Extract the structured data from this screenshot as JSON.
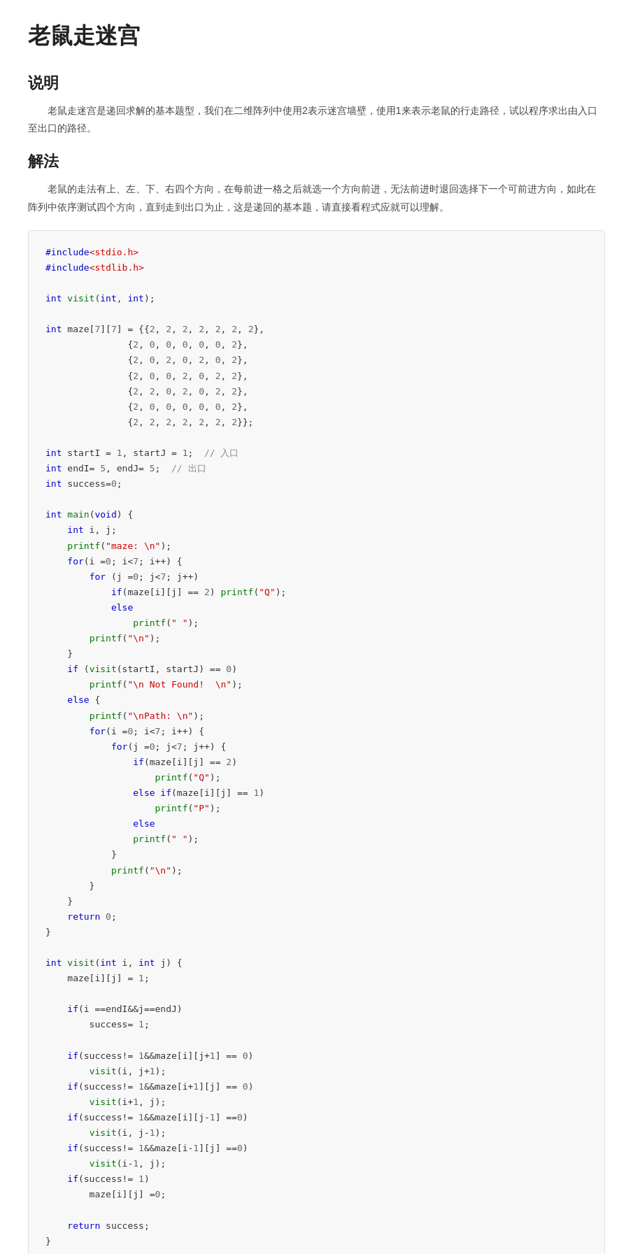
{
  "page": {
    "title": "老鼠走迷宫",
    "sections": [
      {
        "heading": "说明",
        "content": "老鼠走迷宫是递回求解的基本题型，我们在二维阵列中使用2表示迷宫墙壁，使用1来表示老鼠的行走路径，试以程序求出由入口至出口的路径。"
      },
      {
        "heading": "解法",
        "content": "老鼠的走法有上、左、下、右四个方向，在每前进一格之后就选一个方向前进，无法前进时退回选择下一个可前进方向，如此在阵列中依序测试四个方向，直到走到出口为止，这是递回的基本题，请直接看程式应就可以理解。"
      }
    ]
  }
}
